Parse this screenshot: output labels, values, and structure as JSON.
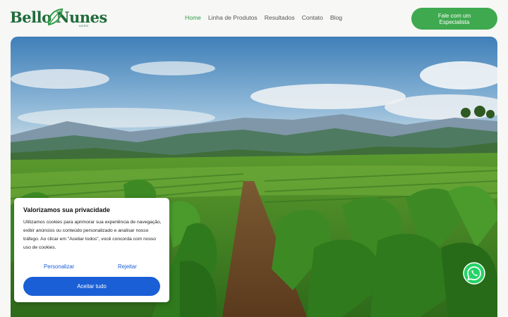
{
  "brand": {
    "name": "Bello Nunes",
    "subtitle": "AGRO"
  },
  "nav": {
    "items": [
      {
        "label": "Home",
        "active": true
      },
      {
        "label": "Linha de Produtos",
        "active": false
      },
      {
        "label": "Resultados",
        "active": false
      },
      {
        "label": "Contato",
        "active": false
      },
      {
        "label": "Blog",
        "active": false
      }
    ]
  },
  "cta": {
    "label": "Fale com um Especialista"
  },
  "cookie_banner": {
    "title": "Valorizamos sua privacidade",
    "body": "Utilizamos cookies para aprimorar sua experiência de navegação, exibir anúncios ou conteúdo personalizado e analisar nosso tráfego. Ao clicar em \"Aceitar todos\", você concorda com nosso uso de cookies.",
    "customize_label": "Personalizar",
    "reject_label": "Rejeitar",
    "accept_label": "Aceitar tudo"
  },
  "icons": {
    "logo_leaf": "leaf-icon",
    "whatsapp": "whatsapp-icon"
  },
  "colors": {
    "brand_green": "#1f6b3a",
    "cta_green": "#3fa94f",
    "active_nav": "#2f9c47",
    "cookie_blue": "#1a5fd6",
    "whatsapp_green": "#25d366"
  }
}
